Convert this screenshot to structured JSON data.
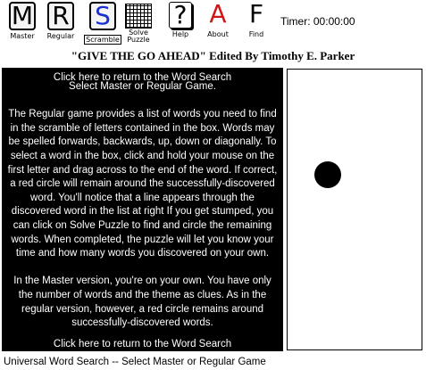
{
  "toolbar": {
    "master": {
      "glyph": "M",
      "label": "Master"
    },
    "regular": {
      "glyph": "R",
      "label": "Regular"
    },
    "scramble": {
      "glyph": "S",
      "label": "Scramble"
    },
    "solve": {
      "label_line1": "Solve",
      "label_line2": "Puzzle"
    },
    "help": {
      "glyph": "?",
      "label": "Help"
    },
    "about": {
      "glyph": "A",
      "label": "About"
    },
    "find": {
      "glyph": "F",
      "label": "Find"
    }
  },
  "colors": {
    "scramble_accent": "#1a2fd0",
    "about_accent": "#d21414",
    "panel_background": "#000000",
    "panel_text": "#ffffff"
  },
  "timer": {
    "text": "Timer: 00:00:00"
  },
  "title": "\"GIVE THE GO AHEAD\" Edited By Timothy E. Parker",
  "info": {
    "link_top": "Click here to return to the Word Search",
    "heading": "Select Master or Regular Game.",
    "paragraph1": "The Regular game provides a list of words you need to find in the scramble of letters contained in the box. Words may be spelled forwards, backwards, up, down or diagonally.  To select a word in the box, click and hold your mouse on the first letter and drag across to the end of the word.  If correct, a red circle will remain around the successfully-discovered word.  You'll notice that a line appears through the discovered word in the list at right If you get stumped, you can click on Solve Puzzle to find and circle the remaining words. When completed, the puzzle will let you know your time and how many words you discovered on your own.",
    "paragraph2": "In the Master version, you're on your own.  You have only the number of words and the theme as clues.  As in the regular version, however, a red circle remains around successfully-discovered words.",
    "link_bottom": "Click here to return to the Word Search"
  },
  "status_bar": "Universal Word Search -- Select Master or Regular Game"
}
